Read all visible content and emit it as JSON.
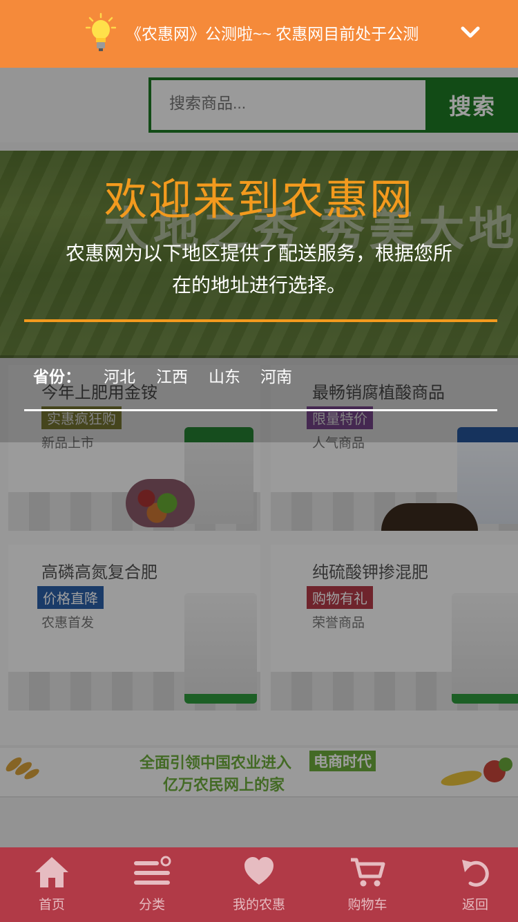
{
  "notice": {
    "icon": "lightbulb-icon",
    "text": "《农惠网》公测啦~~ 农惠网目前处于公测"
  },
  "search": {
    "placeholder": "搜索商品...",
    "button_label": "搜索"
  },
  "banner": {
    "ghost_text": "大地之秀  秀美大地"
  },
  "promos": [
    {
      "title": "今年上肥用金铵",
      "tag": "实惠疯狂购",
      "subtitle": "新品上市",
      "tag_color": "#8a8a3a"
    },
    {
      "title": "最畅销腐植酸商品",
      "tag": "限量特价",
      "subtitle": "人气商品",
      "tag_color": "#8a4fa0"
    },
    {
      "title": "高磷高氮复合肥",
      "tag": "价格直降",
      "subtitle": "农惠首发",
      "tag_color": "#2b5fa8"
    },
    {
      "title": "纯硫酸钾掺混肥",
      "tag": "购物有礼",
      "subtitle": "荣誉商品",
      "tag_color": "#b33b47"
    }
  ],
  "slogan": {
    "line1": "全面引领中国农业进入",
    "badge": "电商时代",
    "line2": "亿万农民网上的家"
  },
  "modal": {
    "heading": "欢迎来到农惠网",
    "description": "农惠网为以下地区提供了配送服务，根据您所在的地址进行选择。",
    "province_label": "省份：",
    "provinces": [
      "河北",
      "江西",
      "山东",
      "河南"
    ],
    "accent_color": "#f39a1e"
  },
  "tabbar": {
    "items": [
      {
        "label": "首页",
        "icon": "home-icon"
      },
      {
        "label": "分类",
        "icon": "category-icon"
      },
      {
        "label": "我的农惠",
        "icon": "heart-icon"
      },
      {
        "label": "购物车",
        "icon": "cart-icon"
      },
      {
        "label": "返回",
        "icon": "back-icon"
      }
    ],
    "background": "#b13a47"
  }
}
